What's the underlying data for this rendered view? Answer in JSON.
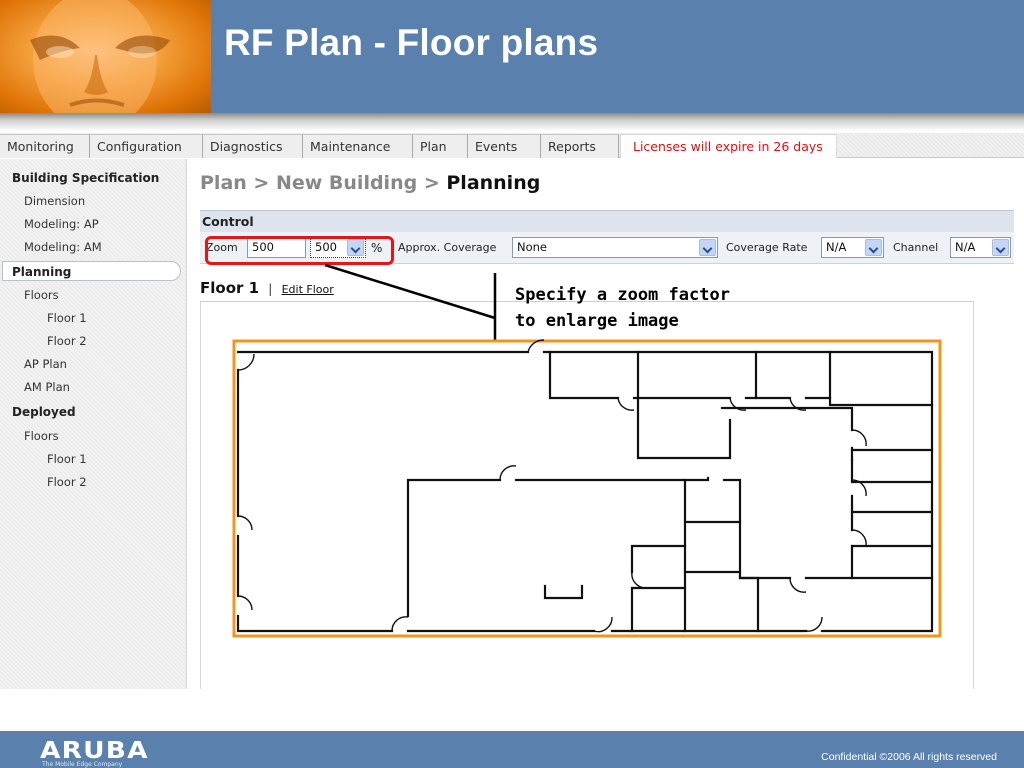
{
  "slide": {
    "title": "RF Plan - Floor plans",
    "callout": "Specify a zoom factor\nto enlarge image",
    "footer_logo": "ARUBA",
    "footer_logo_sub": "The Mobile Edge Company",
    "footer_confidential": "Confidential  ©2006 All rights reserved"
  },
  "tabs": [
    {
      "label": "Monitoring"
    },
    {
      "label": "Configuration"
    },
    {
      "label": "Diagnostics"
    },
    {
      "label": "Maintenance"
    },
    {
      "label": "Plan"
    },
    {
      "label": "Events"
    },
    {
      "label": "Reports"
    }
  ],
  "license_notice": "Licenses will expire in 26 days",
  "sidebar": {
    "building_spec": "Building Specification",
    "dimension": "Dimension",
    "modeling_ap": "Modeling: AP",
    "modeling_am": "Modeling: AM",
    "planning": "Planning",
    "floors": "Floors",
    "floor1": "Floor 1",
    "floor2": "Floor 2",
    "ap_plan": "AP Plan",
    "am_plan": "AM Plan",
    "deployed": "Deployed",
    "deployed_floors": "Floors",
    "deployed_floor1": "Floor 1",
    "deployed_floor2": "Floor 2"
  },
  "breadcrumb": {
    "plan": "Plan",
    "sep": ">",
    "building": "New Building",
    "current": "Planning"
  },
  "control": {
    "title": "Control",
    "zoom_label": "Zoom",
    "zoom_value": "500",
    "zoom_select": "500",
    "percent": "%",
    "coverage_label": "Approx. Coverage",
    "coverage_value": "None",
    "rate_label": "Coverage Rate",
    "rate_value": "N/A",
    "channel_label": "Channel",
    "channel_value": "N/A"
  },
  "floor": {
    "title": "Floor 1",
    "sep": "|",
    "edit_link": "Edit Floor"
  },
  "colors": {
    "header_blue": "#5a80ad",
    "highlight_red": "#e01818",
    "plan_border_orange": "#f0961e"
  }
}
